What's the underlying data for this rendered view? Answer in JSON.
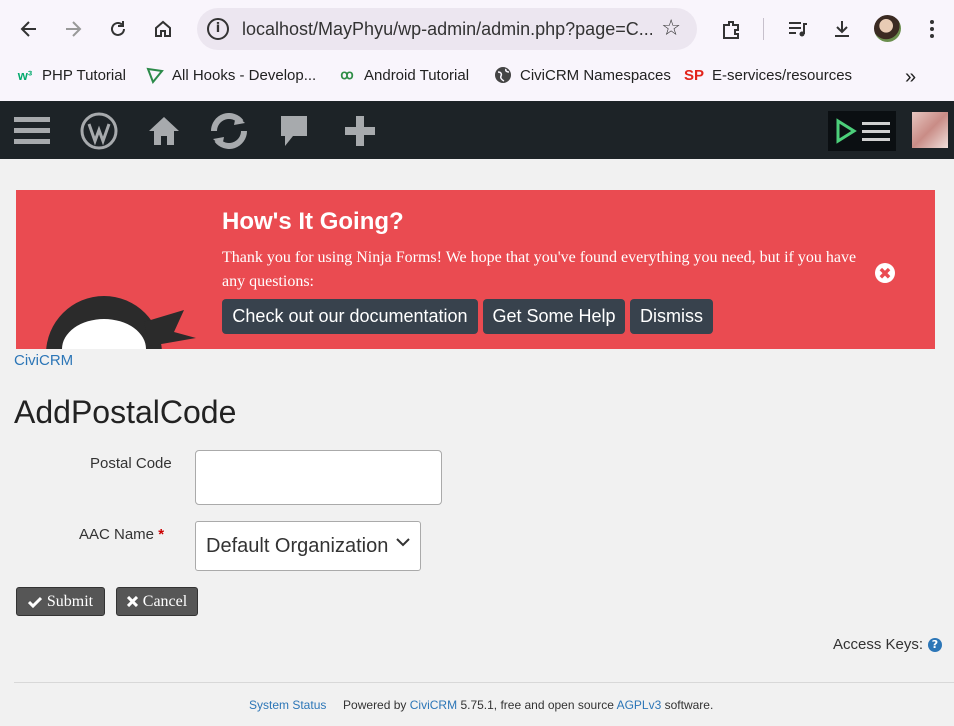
{
  "browser": {
    "url": "localhost/MayPhyu/wp-admin/admin.php?page=C...",
    "bookmarks": [
      {
        "label": "PHP Tutorial",
        "icon": "w3schools-icon"
      },
      {
        "label": "All Hooks - Develop...",
        "icon": "triangle-icon"
      },
      {
        "label": "Android Tutorial",
        "icon": "geeks-icon"
      },
      {
        "label": "CiviCRM Namespaces",
        "icon": "globe-icon"
      },
      {
        "label": "E-services/resources",
        "icon": "sp-icon",
        "icon_text": "SP"
      }
    ],
    "overflow_label": "»"
  },
  "notice": {
    "title": "How's It Going?",
    "text": "Thank you for using Ninja Forms! We hope that you've found everything you need, but if you have any questions:",
    "buttons": [
      "Check out our documentation",
      "Get Some Help",
      "Dismiss"
    ],
    "close_glyph": "✖"
  },
  "breadcrumb": "CiviCRM",
  "page_title": "AddPostalCode",
  "form": {
    "postal_code_label": "Postal Code",
    "postal_code_value": "",
    "aac_name_label": "AAC Name",
    "aac_required": "*",
    "aac_selected": "Default Organization"
  },
  "actions": {
    "submit_label": "Submit",
    "cancel_label": "Cancel"
  },
  "access_keys_label": "Access Keys:",
  "footer": {
    "system_status": "System Status",
    "powered_by": "Powered by",
    "civicrm_link": "CiviCRM",
    "version_text": "5.75.1, free and open source",
    "license_link": "AGPLv3",
    "software": "software."
  },
  "colors": {
    "notice_bg": "#ea4b51",
    "adminbar_bg": "#1d2327",
    "link": "#2c76b7"
  }
}
